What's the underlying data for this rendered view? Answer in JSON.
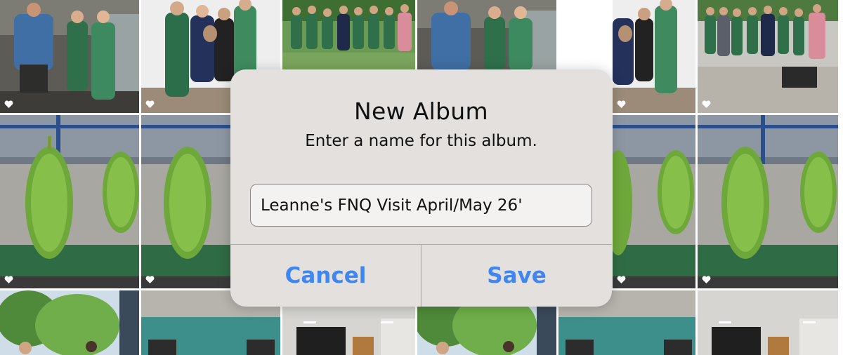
{
  "dialog": {
    "title": "New Album",
    "message": "Enter a name for this album.",
    "input_value": "Leanne's FNQ Visit April/May 26'",
    "cancel_label": "Cancel",
    "save_label": "Save"
  },
  "colors": {
    "accent": "#3f86f0",
    "dialog_bg": "#e3e0dd"
  },
  "photos": [
    {
      "subject": "team-in-shed",
      "favorite": true
    },
    {
      "subject": "team-with-dog",
      "favorite": true
    },
    {
      "subject": "group-on-grass",
      "favorite": false
    },
    {
      "subject": "team-in-shed",
      "favorite": false
    },
    {
      "subject": "team-with-dog",
      "favorite": true
    },
    {
      "subject": "group-on-grass",
      "favorite": true
    },
    {
      "subject": "banana-bunches",
      "favorite": true
    },
    {
      "subject": "banana-bunches",
      "favorite": true
    },
    {
      "subject": "banana-bunches",
      "favorite": false
    },
    {
      "subject": "banana-bunches",
      "favorite": true
    },
    {
      "subject": "garden-group",
      "favorite": false
    },
    {
      "subject": "teal-building",
      "favorite": false
    },
    {
      "subject": "indoor-office",
      "favorite": false
    },
    {
      "subject": "garden-group",
      "favorite": false
    },
    {
      "subject": "teal-building",
      "favorite": false
    },
    {
      "subject": "indoor-office",
      "favorite": false
    }
  ]
}
